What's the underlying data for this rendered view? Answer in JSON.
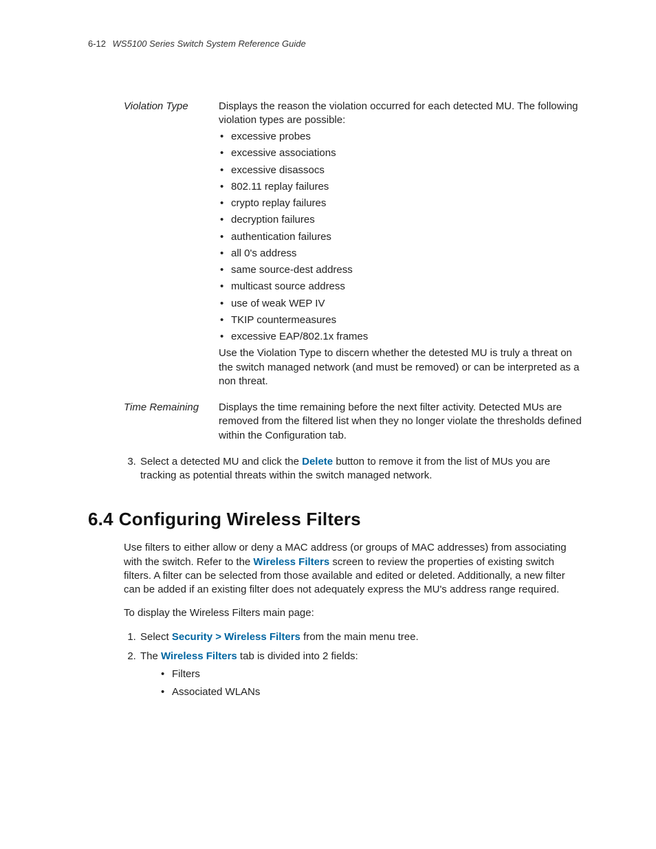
{
  "header": {
    "page_number": "6-12",
    "doc_title": "WS5100 Series Switch System Reference Guide"
  },
  "definitions": {
    "violation_type": {
      "label": "Violation Type",
      "intro": "Displays the reason the violation occurred for each detected MU. The following violation types are possible:",
      "items": [
        "excessive probes",
        "excessive associations",
        "excessive disassocs",
        "802.11 replay failures",
        "crypto replay failures",
        "decryption failures",
        "authentication failures",
        "all 0's address",
        "same source-dest address",
        "multicast source address",
        "use of weak WEP IV",
        "TKIP countermeasures",
        "excessive EAP/802.1x frames"
      ],
      "outro": "Use the Violation Type to discern whether the detested MU is truly a threat on the switch managed network (and must be removed) or can be interpreted as a non threat."
    },
    "time_remaining": {
      "label": "Time Remaining",
      "text": "Displays the time remaining before the next filter activity. Detected MUs are removed from the filtered list when they no longer violate the thresholds defined within the Configuration tab."
    }
  },
  "step3": {
    "pre": "Select a detected MU and click the ",
    "bold": "Delete",
    "post": " button to remove it from the list of MUs you are tracking as potential threats within the switch managed network."
  },
  "section": {
    "number": "6.4",
    "title": "Configuring Wireless Filters",
    "para1_a": "Use filters to either allow or deny a MAC address (or groups of MAC addresses) from associating with the switch. Refer to the ",
    "para1_link": "Wireless Filters",
    "para1_b": " screen to review the properties of existing switch filters. A filter can be selected from those available and edited or deleted. Additionally, a new filter can be added if an existing filter does not adequately express the MU's address range required.",
    "para2": "To display the Wireless Filters main page:",
    "steps": {
      "s1_a": "Select ",
      "s1_link": "Security > Wireless Filters",
      "s1_b": " from the main menu tree.",
      "s2_a": "The ",
      "s2_link": "Wireless Filters",
      "s2_b": " tab is divided into 2 fields:",
      "sub": [
        "Filters",
        "Associated WLANs"
      ]
    }
  }
}
